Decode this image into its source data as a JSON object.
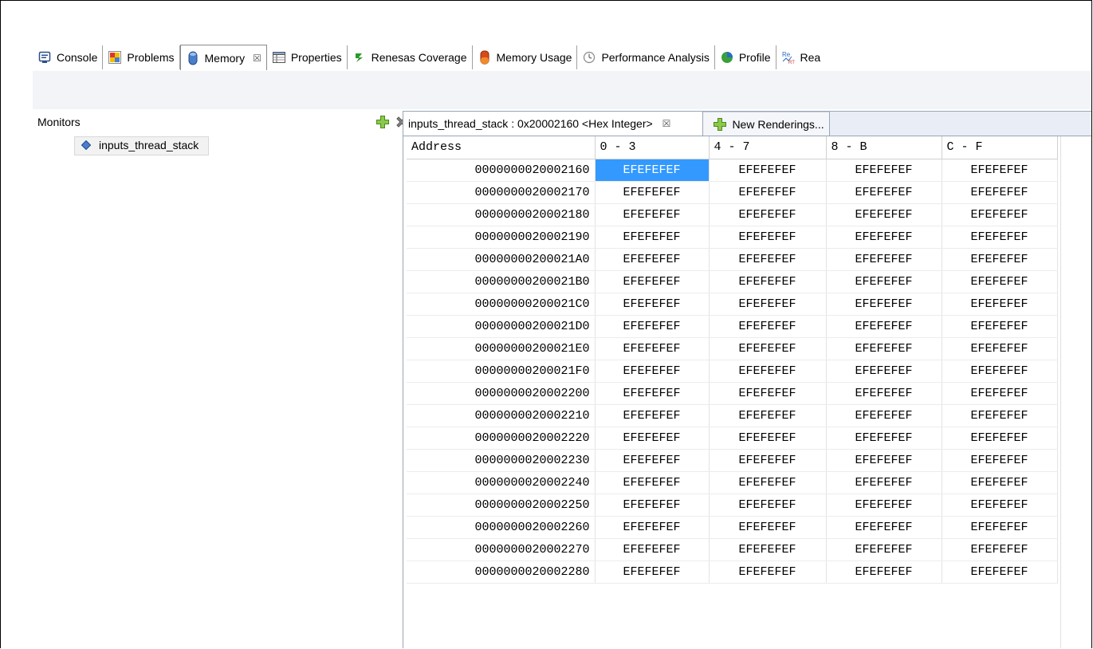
{
  "top_tabs": [
    {
      "label": "Console",
      "icon": "console-icon",
      "active": false
    },
    {
      "label": "Problems",
      "icon": "problems-icon",
      "active": false
    },
    {
      "label": "Memory",
      "icon": "memory-icon",
      "active": true,
      "close": "☒"
    },
    {
      "label": "Properties",
      "icon": "properties-icon",
      "active": false
    },
    {
      "label": "Renesas Coverage",
      "icon": "coverage-icon",
      "active": false
    },
    {
      "label": "Memory Usage",
      "icon": "memory-usage-icon",
      "active": false
    },
    {
      "label": "Performance Analysis",
      "icon": "performance-icon",
      "active": false
    },
    {
      "label": "Profile",
      "icon": "profile-icon",
      "active": false
    },
    {
      "label": "Rea",
      "icon": "realtime-icon",
      "active": false
    }
  ],
  "monitors": {
    "title": "Monitors",
    "items": [
      {
        "label": "inputs_thread_stack"
      }
    ]
  },
  "rendering": {
    "active_tab": "inputs_thread_stack : 0x20002160 <Hex Integer>",
    "active_tab_close": "☒",
    "new_tab": "New Renderings...",
    "columns": [
      "Address",
      "0 - 3",
      "4 - 7",
      "8 - B",
      "C - F"
    ],
    "rows": [
      {
        "addr": "0000000020002160",
        "cells": [
          "EFEFEFEF",
          "EFEFEFEF",
          "EFEFEFEF",
          "EFEFEFEF"
        ]
      },
      {
        "addr": "0000000020002170",
        "cells": [
          "EFEFEFEF",
          "EFEFEFEF",
          "EFEFEFEF",
          "EFEFEFEF"
        ]
      },
      {
        "addr": "0000000020002180",
        "cells": [
          "EFEFEFEF",
          "EFEFEFEF",
          "EFEFEFEF",
          "EFEFEFEF"
        ]
      },
      {
        "addr": "0000000020002190",
        "cells": [
          "EFEFEFEF",
          "EFEFEFEF",
          "EFEFEFEF",
          "EFEFEFEF"
        ]
      },
      {
        "addr": "00000000200021A0",
        "cells": [
          "EFEFEFEF",
          "EFEFEFEF",
          "EFEFEFEF",
          "EFEFEFEF"
        ]
      },
      {
        "addr": "00000000200021B0",
        "cells": [
          "EFEFEFEF",
          "EFEFEFEF",
          "EFEFEFEF",
          "EFEFEFEF"
        ]
      },
      {
        "addr": "00000000200021C0",
        "cells": [
          "EFEFEFEF",
          "EFEFEFEF",
          "EFEFEFEF",
          "EFEFEFEF"
        ]
      },
      {
        "addr": "00000000200021D0",
        "cells": [
          "EFEFEFEF",
          "EFEFEFEF",
          "EFEFEFEF",
          "EFEFEFEF"
        ]
      },
      {
        "addr": "00000000200021E0",
        "cells": [
          "EFEFEFEF",
          "EFEFEFEF",
          "EFEFEFEF",
          "EFEFEFEF"
        ]
      },
      {
        "addr": "00000000200021F0",
        "cells": [
          "EFEFEFEF",
          "EFEFEFEF",
          "EFEFEFEF",
          "EFEFEFEF"
        ]
      },
      {
        "addr": "0000000020002200",
        "cells": [
          "EFEFEFEF",
          "EFEFEFEF",
          "EFEFEFEF",
          "EFEFEFEF"
        ]
      },
      {
        "addr": "0000000020002210",
        "cells": [
          "EFEFEFEF",
          "EFEFEFEF",
          "EFEFEFEF",
          "EFEFEFEF"
        ]
      },
      {
        "addr": "0000000020002220",
        "cells": [
          "EFEFEFEF",
          "EFEFEFEF",
          "EFEFEFEF",
          "EFEFEFEF"
        ]
      },
      {
        "addr": "0000000020002230",
        "cells": [
          "EFEFEFEF",
          "EFEFEFEF",
          "EFEFEFEF",
          "EFEFEFEF"
        ]
      },
      {
        "addr": "0000000020002240",
        "cells": [
          "EFEFEFEF",
          "EFEFEFEF",
          "EFEFEFEF",
          "EFEFEFEF"
        ]
      },
      {
        "addr": "0000000020002250",
        "cells": [
          "EFEFEFEF",
          "EFEFEFEF",
          "EFEFEFEF",
          "EFEFEFEF"
        ]
      },
      {
        "addr": "0000000020002260",
        "cells": [
          "EFEFEFEF",
          "EFEFEFEF",
          "EFEFEFEF",
          "EFEFEFEF"
        ]
      },
      {
        "addr": "0000000020002270",
        "cells": [
          "EFEFEFEF",
          "EFEFEFEF",
          "EFEFEFEF",
          "EFEFEFEF"
        ]
      },
      {
        "addr": "0000000020002280",
        "cells": [
          "EFEFEFEF",
          "EFEFEFEF",
          "EFEFEFEF",
          "EFEFEFEF"
        ]
      }
    ],
    "selected": {
      "row": 0,
      "col": 0
    }
  },
  "colors": {
    "selection": "#3399ff",
    "tab_band": "#e9eef6",
    "toolbar_band": "#f2f4f7"
  }
}
